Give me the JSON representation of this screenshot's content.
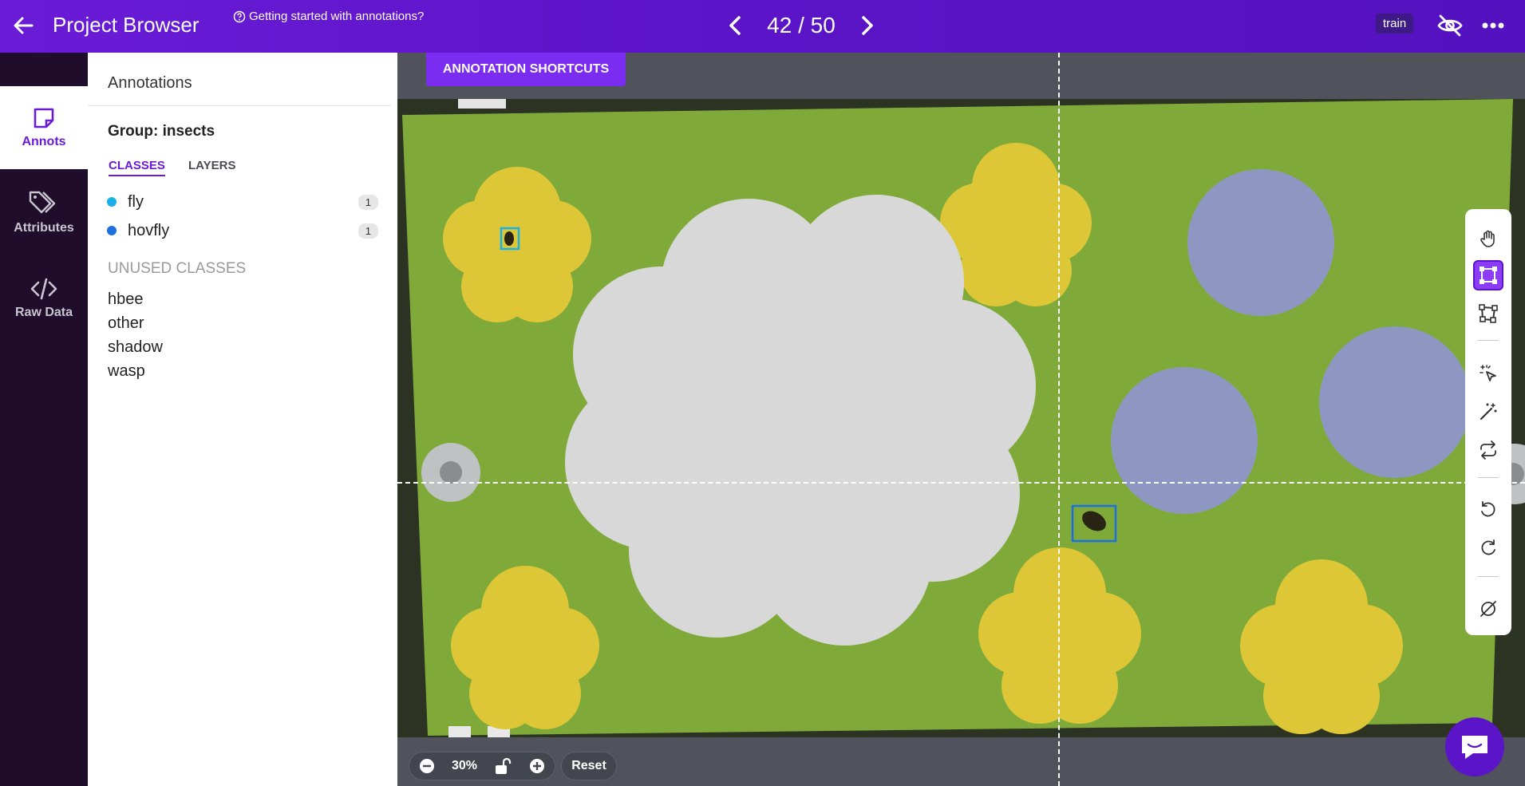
{
  "topbar": {
    "title": "Project Browser",
    "help_link": "Getting started with annotations?",
    "counter": "42 / 50",
    "split_badge": "train"
  },
  "nav": {
    "items": [
      {
        "label": "Annots",
        "icon": "sticky-note-icon",
        "active": true
      },
      {
        "label": "Attributes",
        "icon": "tags-icon",
        "active": false
      },
      {
        "label": "Raw Data",
        "icon": "code-icon",
        "active": false
      }
    ]
  },
  "panel": {
    "title": "Annotations",
    "group": "Group: insects",
    "tabs": {
      "classes": "CLASSES",
      "layers": "LAYERS"
    },
    "classes": [
      {
        "name": "fly",
        "count": "1",
        "color": "#1ab0e8"
      },
      {
        "name": "hovfly",
        "count": "1",
        "color": "#1e6fe0"
      }
    ],
    "unused_title": "UNUSED CLASSES",
    "unused": [
      "hbee",
      "other",
      "shadow",
      "wasp"
    ]
  },
  "canvas": {
    "shortcuts_label": "ANNOTATION SHORTCUTS",
    "zoom": "30%",
    "reset_label": "Reset",
    "colors": {
      "board": "#7faa3a",
      "yellow": "#ddc736",
      "blue": "#8d97c2",
      "white": "#d8d8d8",
      "annotation_fly": "#1ab0e8",
      "annotation_hovfly": "#1e6fe0"
    }
  },
  "toolbar": {
    "tools": [
      "hand-icon",
      "bounding-box-icon",
      "polygon-icon",
      "magic-select-icon",
      "magic-wand-icon",
      "swap-icon",
      "undo-icon",
      "redo-icon",
      "clear-icon"
    ],
    "active": "bounding-box-icon"
  }
}
